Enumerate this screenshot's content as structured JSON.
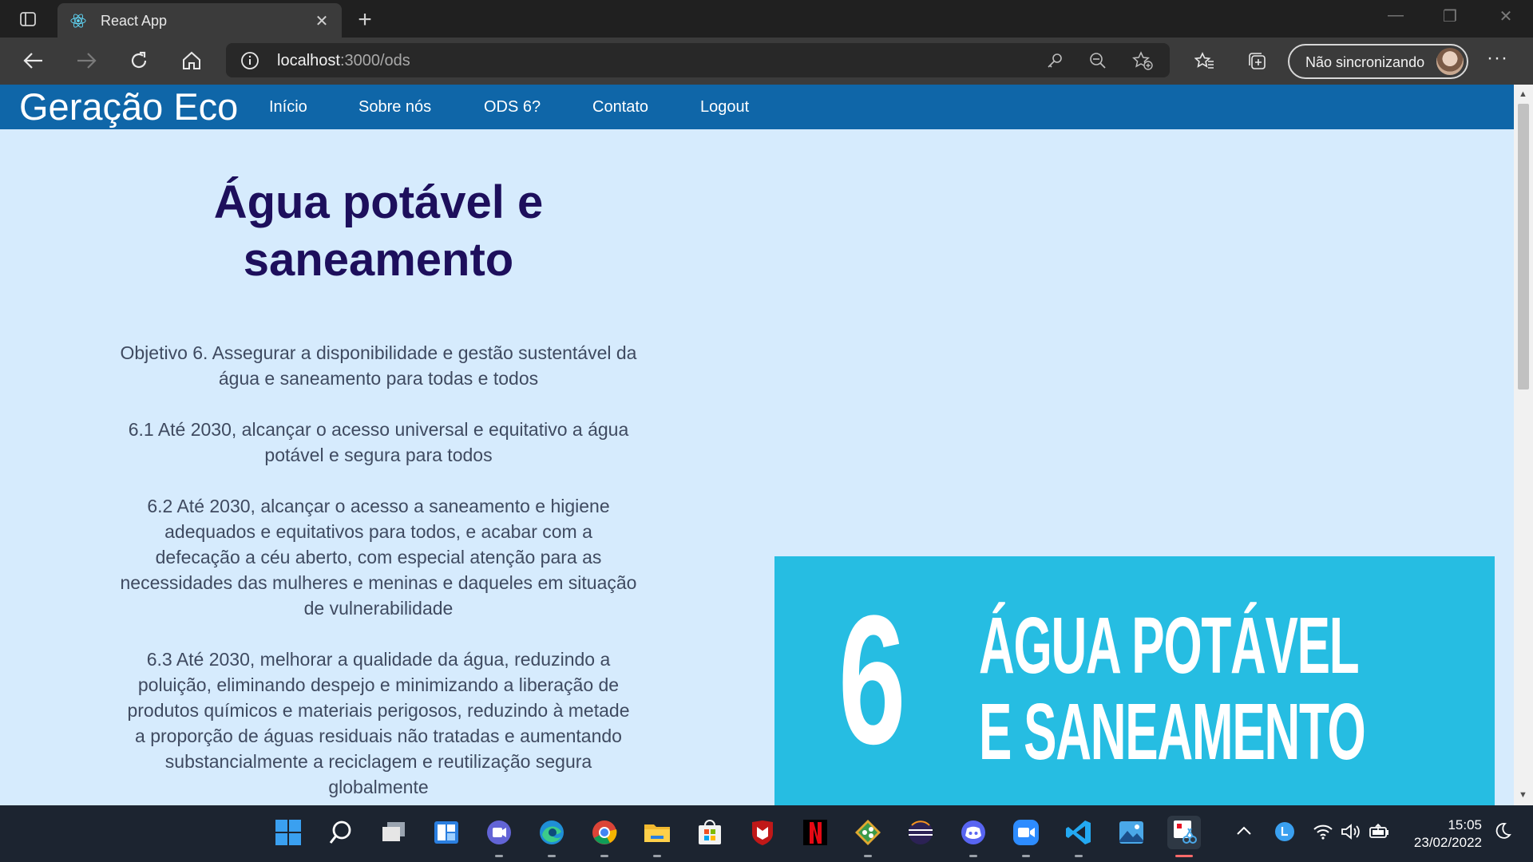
{
  "browser": {
    "tab_title": "React App",
    "url_host": "localhost",
    "url_rest": ":3000/ods",
    "profile_label": "Não sincronizando"
  },
  "site": {
    "brand": "Geração Eco",
    "nav": [
      "Início",
      "Sobre nós",
      "ODS 6?",
      "Contato",
      "Logout"
    ]
  },
  "main": {
    "heading_line1": "Água potável e",
    "heading_line2": "saneamento",
    "paragraphs": [
      "Objetivo 6. Assegurar a disponibilidade e gestão sustentável da água e saneamento para todas e todos",
      "6.1 Até 2030, alcançar o acesso universal e equitativo a água potável e segura para todos",
      "6.2 Até 2030, alcançar o acesso a saneamento e higiene adequados e equitativos para todos, e acabar com a defecação a céu aberto, com especial atenção para as necessidades das mulheres e meninas e daqueles em situação de vulnerabilidade",
      "6.3 Até 2030, melhorar a qualidade da água, reduzindo a poluição, eliminando despejo e minimizando a liberação de produtos químicos e materiais perigosos, reduzindo à metade a proporção de águas residuais não tratadas e aumentando substancialmente a reciclagem e reutilização segura globalmente"
    ]
  },
  "sdg_card": {
    "number": "6",
    "title_line1": "ÁGUA POTÁVEL",
    "title_line2": "E SANEAMENTO",
    "color": "#26bde2"
  },
  "taskbar": {
    "time": "15:05",
    "date": "23/02/2022",
    "apps": [
      "start-icon",
      "search-icon",
      "task-view-icon",
      "widgets-icon",
      "teams-chat-icon",
      "edge-icon",
      "chrome-icon",
      "file-explorer-icon",
      "store-icon",
      "mcafee-icon",
      "netflix-icon",
      "git-icon",
      "eclipse-icon",
      "discord-icon",
      "zoom-icon",
      "vscode-icon",
      "photos-icon",
      "snipping-tool-icon"
    ]
  },
  "colors": {
    "site_nav": "#0f66a8",
    "page_bg": "#d6ebfd",
    "heading": "#1d0f5c",
    "paragraph": "#3f4a60"
  }
}
